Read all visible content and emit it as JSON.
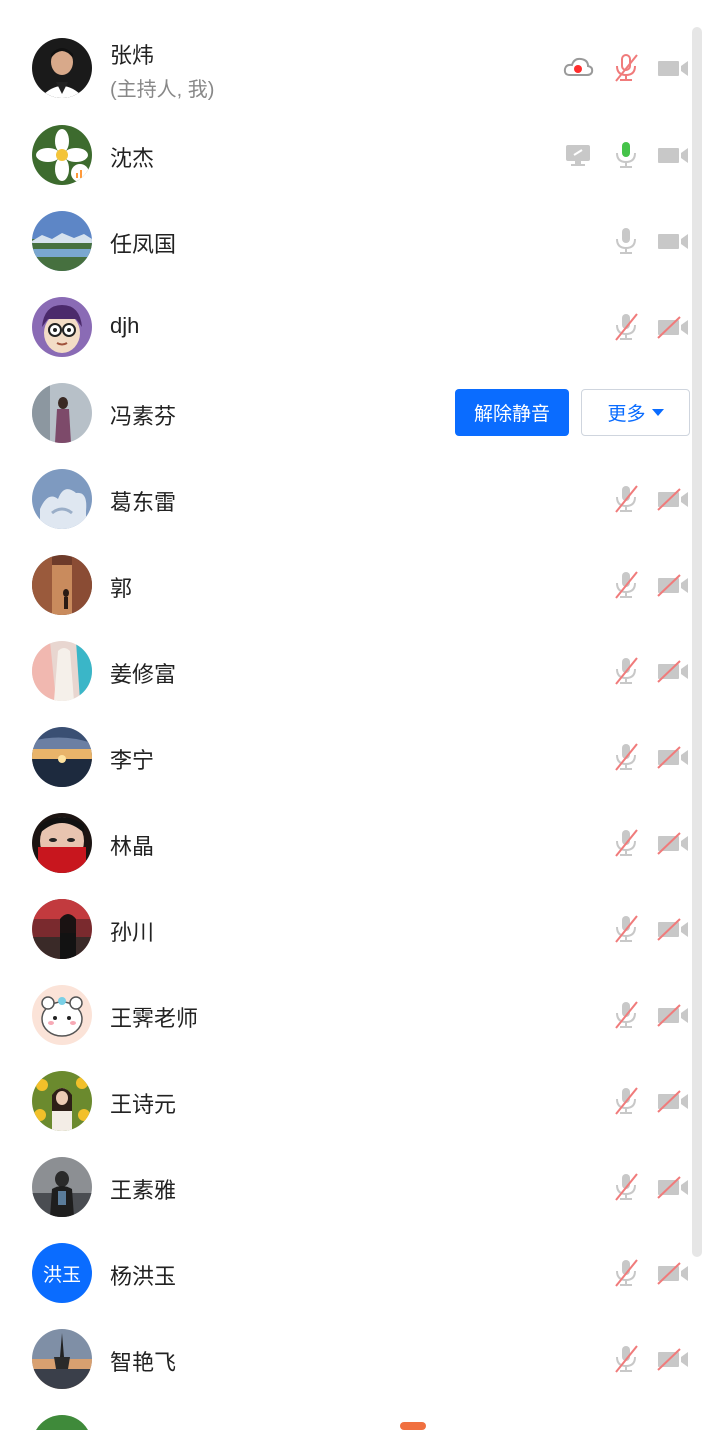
{
  "participants": [
    {
      "name": "张炜",
      "subtitle": "(主持人, 我)",
      "avatar": "photo",
      "mic": "muted",
      "cam": "off",
      "extra": "recording"
    },
    {
      "name": "沈杰",
      "mic": "active",
      "cam": "off",
      "extra": "screen-share"
    },
    {
      "name": "任凤国",
      "mic": "idle",
      "cam": "off"
    },
    {
      "name": "djh",
      "mic": "muted",
      "cam": "disabled"
    },
    {
      "name": "冯素芬",
      "hover": true
    },
    {
      "name": "葛东雷",
      "mic": "muted",
      "cam": "disabled"
    },
    {
      "name": "郭",
      "mic": "muted",
      "cam": "disabled"
    },
    {
      "name": "姜修富",
      "mic": "muted",
      "cam": "disabled"
    },
    {
      "name": "李宁",
      "mic": "muted",
      "cam": "disabled"
    },
    {
      "name": "林晶",
      "mic": "muted",
      "cam": "disabled"
    },
    {
      "name": "孙川",
      "mic": "muted",
      "cam": "disabled"
    },
    {
      "name": "王霁老师",
      "mic": "muted",
      "cam": "disabled"
    },
    {
      "name": "王诗元",
      "mic": "muted",
      "cam": "disabled"
    },
    {
      "name": "王素雅",
      "mic": "muted",
      "cam": "disabled"
    },
    {
      "name": "杨洪玉",
      "avatar_text": "洪玉",
      "mic": "muted",
      "cam": "disabled"
    },
    {
      "name": "智艳飞",
      "mic": "muted",
      "cam": "disabled"
    }
  ],
  "actions": {
    "unmute": "解除静音",
    "more": "更多"
  },
  "colors": {
    "accent": "#0a6cff",
    "muted_red": "#f07b7b",
    "active_green": "#45c34a",
    "icon_gray": "#c8c8c8"
  }
}
